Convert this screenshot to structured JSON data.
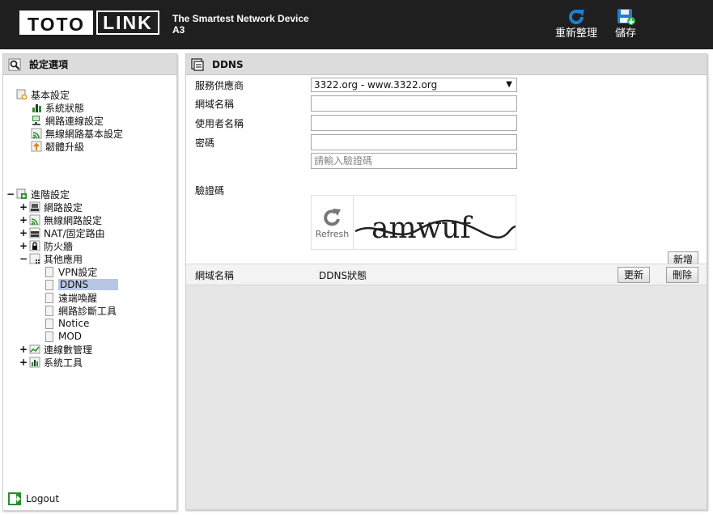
{
  "header": {
    "logo_left": "TOTO",
    "logo_right": "LINK",
    "tagline": "The Smartest Network Device",
    "model": "A3",
    "refresh_label": "重新整理",
    "save_label": "儲存"
  },
  "sidebar": {
    "title": "設定選項",
    "basic": {
      "label": "基本設定",
      "items": [
        "系統狀態",
        "網路連線設定",
        "無線網路基本設定",
        "韌體升級"
      ]
    },
    "advanced": {
      "label": "進階設定",
      "items": [
        "網路設定",
        "無線網路設定",
        "NAT/固定路由",
        "防火牆",
        "其他應用"
      ],
      "other_apps": [
        "VPN設定",
        "DDNS",
        "遠端喚醒",
        "網路診斷工具",
        "Notice",
        "MOD"
      ],
      "more": [
        "連線數管理",
        "系統工具"
      ]
    },
    "logout": "Logout"
  },
  "main": {
    "title": "DDNS",
    "form": {
      "provider_label": "服務供應商",
      "provider_value": "3322.org - www.3322.org",
      "domain_label": "網域名稱",
      "username_label": "使用者名稱",
      "password_label": "密碼",
      "captcha_placeholder": "請輸入驗證碼",
      "captcha_label": "驗證碼",
      "refresh_text": "Refresh",
      "captcha_text": "amwuf",
      "add_button": "新增"
    },
    "table": {
      "col_domain": "網域名稱",
      "col_status": "DDNS狀態",
      "update_button": "更新",
      "delete_button": "刪除"
    }
  },
  "colors": {
    "header_bg": "#1f1f1f",
    "selected_bg": "#b7c7e3",
    "icon_blue": "#1d7fd1"
  }
}
